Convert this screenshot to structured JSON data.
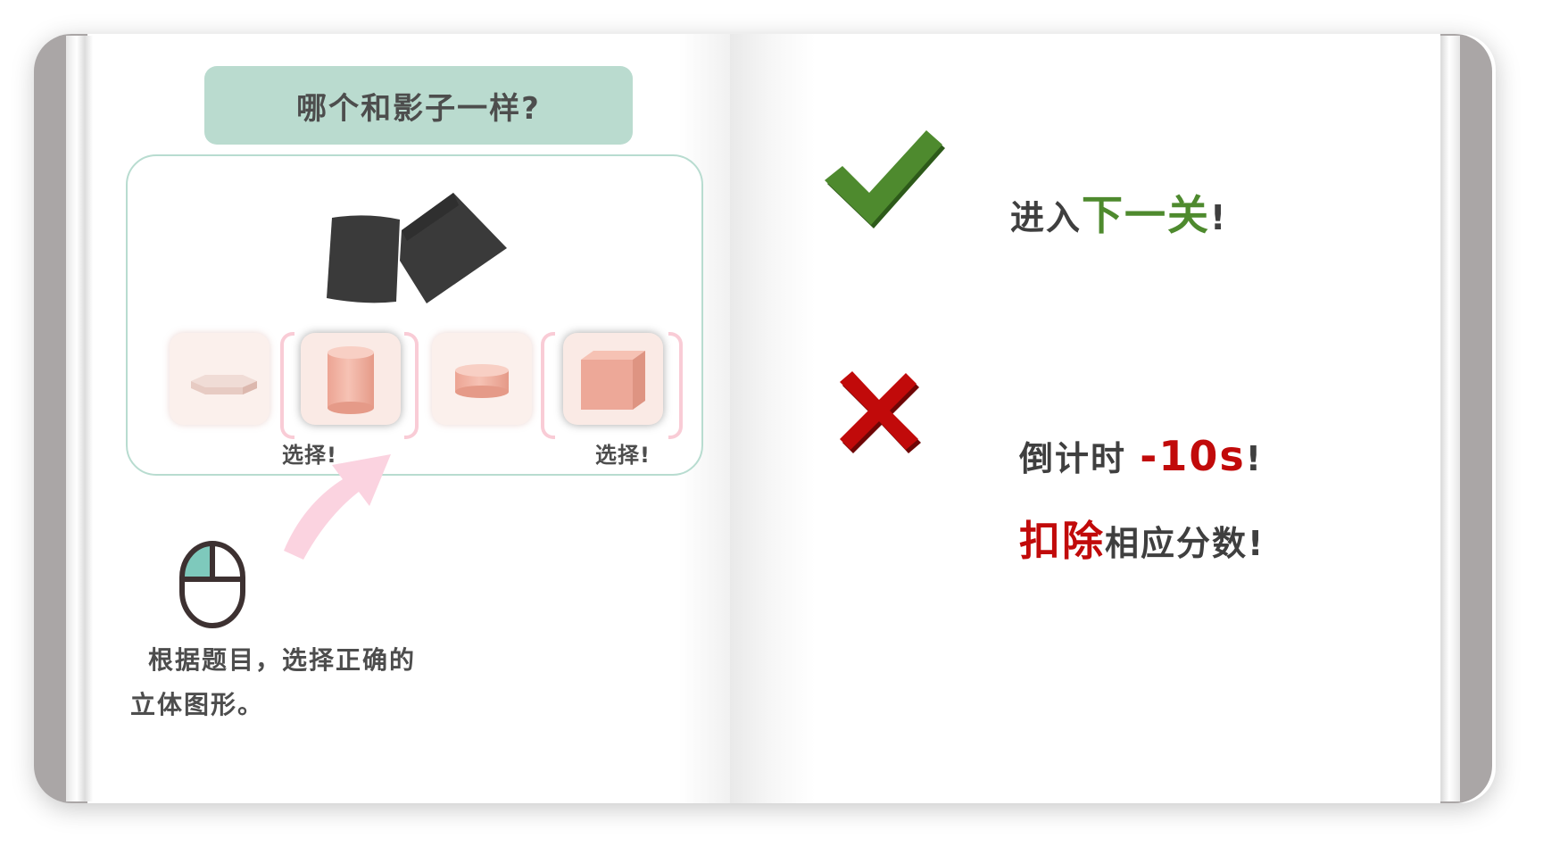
{
  "question": {
    "title": "哪个和影子一样?"
  },
  "options": [
    {
      "shape": "hexagonal-prism",
      "selected": false
    },
    {
      "shape": "cylinder",
      "selected": true
    },
    {
      "shape": "short-cylinder",
      "selected": false
    },
    {
      "shape": "cube",
      "selected": true
    }
  ],
  "select_labels": [
    "选择!",
    "选择!"
  ],
  "instruction": {
    "line1": "根据题目，选择正确的",
    "line2": "立体图形。"
  },
  "correct": {
    "prefix": "进入",
    "highlight": "下一关",
    "suffix": "!"
  },
  "wrong": {
    "line1_prefix": "倒计时 ",
    "line1_highlight": "-10s",
    "line1_suffix": "!",
    "line2_highlight": "扣除",
    "line2_rest": "相应分数!"
  },
  "icons": {
    "correct": "check-icon",
    "wrong": "cross-icon",
    "mouse": "mouse-left-click-icon",
    "pointer": "pointer-arrow-icon"
  },
  "colors": {
    "title_bg": "#badbcf",
    "green": "#4e8a2e",
    "red": "#c10a0a",
    "option_shape": "#eea898",
    "bracket": "#f9ccd6",
    "arrow": "#fbd3e0"
  }
}
